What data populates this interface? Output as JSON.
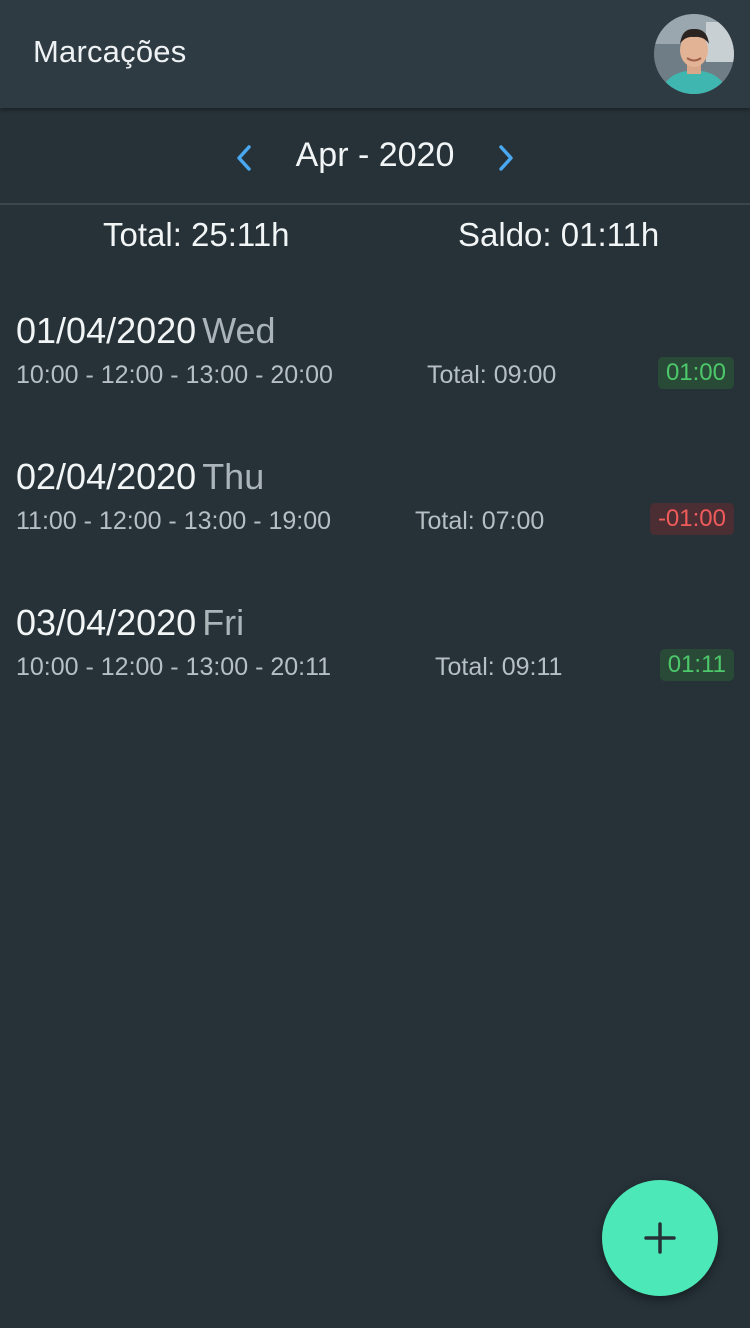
{
  "header": {
    "title": "Marcações"
  },
  "month_nav": {
    "label": "Apr - 2020",
    "prev_icon": "chevron-left-icon",
    "next_icon": "chevron-right-icon"
  },
  "summary": {
    "total": "Total: 25:11h",
    "saldo": "Saldo: 01:11h"
  },
  "entries": [
    {
      "date": "01/04/2020",
      "weekday": "Wed",
      "times": "10:00 - 12:00 - 13:00 - 20:00",
      "total": "Total: 09:00",
      "balance": "01:00",
      "balance_sign": "positive"
    },
    {
      "date": "02/04/2020",
      "weekday": "Thu",
      "times": "11:00 - 12:00 - 13:00 - 19:00",
      "total": "Total: 07:00",
      "balance": "-01:00",
      "balance_sign": "negative"
    },
    {
      "date": "03/04/2020",
      "weekday": "Fri",
      "times": "10:00 - 12:00 - 13:00 - 20:11",
      "total": "Total: 09:11",
      "balance": "01:11",
      "balance_sign": "positive"
    }
  ],
  "fab": {
    "icon": "plus-icon"
  },
  "colors": {
    "background": "#263238",
    "header": "#2e3b42",
    "accent": "#4de8b8",
    "nav_arrow": "#4aa8f0",
    "positive": "#4cc76a",
    "negative": "#ef5a5a"
  }
}
